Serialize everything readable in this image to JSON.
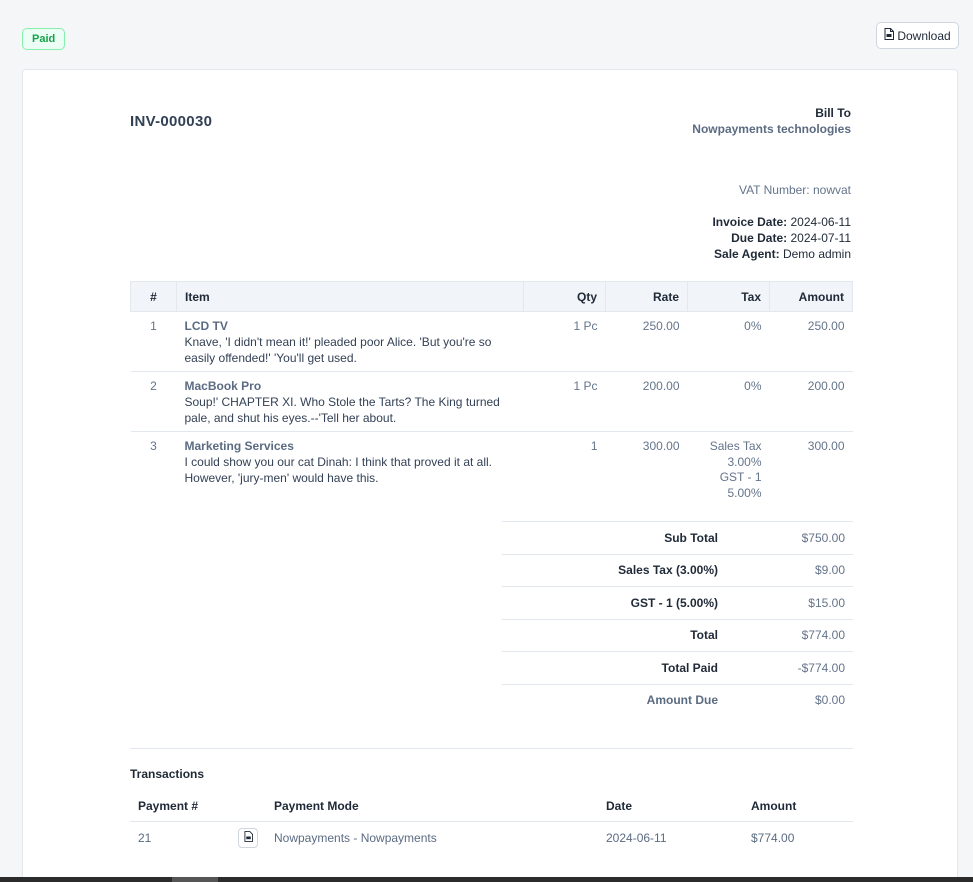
{
  "status": "Paid",
  "download_label": "Download",
  "invoice": {
    "number": "INV-000030",
    "bill_to_label": "Bill To",
    "customer": "Nowpayments technologies",
    "vat": "VAT Number: nowvat",
    "invoice_date_label": "Invoice Date:",
    "invoice_date": "2024-06-11",
    "due_date_label": "Due Date:",
    "due_date": "2024-07-11",
    "sale_agent_label": "Sale Agent:",
    "sale_agent": "Demo admin"
  },
  "items_table": {
    "headers": {
      "num": "#",
      "item": "Item",
      "qty": "Qty",
      "rate": "Rate",
      "tax": "Tax",
      "amount": "Amount"
    },
    "rows": [
      {
        "num": "1",
        "name": "LCD TV",
        "desc": "Knave, 'I didn't mean it!' pleaded poor Alice. 'But you're so easily offended!' 'You'll get used.",
        "qty": "1 Pc",
        "rate": "250.00",
        "tax": [
          "0%"
        ],
        "amount": "250.00"
      },
      {
        "num": "2",
        "name": "MacBook Pro",
        "desc": "Soup!' CHAPTER XI. Who Stole the Tarts? The King turned pale, and shut his eyes.--'Tell her about.",
        "qty": "1 Pc",
        "rate": "200.00",
        "tax": [
          "0%"
        ],
        "amount": "200.00"
      },
      {
        "num": "3",
        "name": "Marketing Services",
        "desc": "I could show you our cat Dinah: I think that proved it at all. However, 'jury-men' would have this.",
        "qty": "1",
        "rate": "300.00",
        "tax": [
          "Sales Tax",
          "3.00%",
          "GST - 1",
          "5.00%"
        ],
        "amount": "300.00"
      }
    ]
  },
  "totals": [
    {
      "label": "Sub Total",
      "value": "$750.00"
    },
    {
      "label": "Sales Tax (3.00%)",
      "value": "$9.00"
    },
    {
      "label": "GST - 1 (5.00%)",
      "value": "$15.00"
    },
    {
      "label": "Total",
      "value": "$774.00"
    },
    {
      "label": "Total Paid",
      "value": "-$774.00"
    },
    {
      "label": "Amount Due",
      "value": "$0.00"
    }
  ],
  "transactions": {
    "title": "Transactions",
    "headers": {
      "payment_num": "Payment #",
      "mode": "Payment Mode",
      "date": "Date",
      "amount": "Amount"
    },
    "rows": [
      {
        "payment_num": "21",
        "mode": "Nowpayments - Nowpayments",
        "date": "2024-06-11",
        "amount": "$774.00"
      }
    ]
  },
  "colors": {
    "paid_badge": "#16a34a",
    "accent_text": "#5b6b82"
  }
}
